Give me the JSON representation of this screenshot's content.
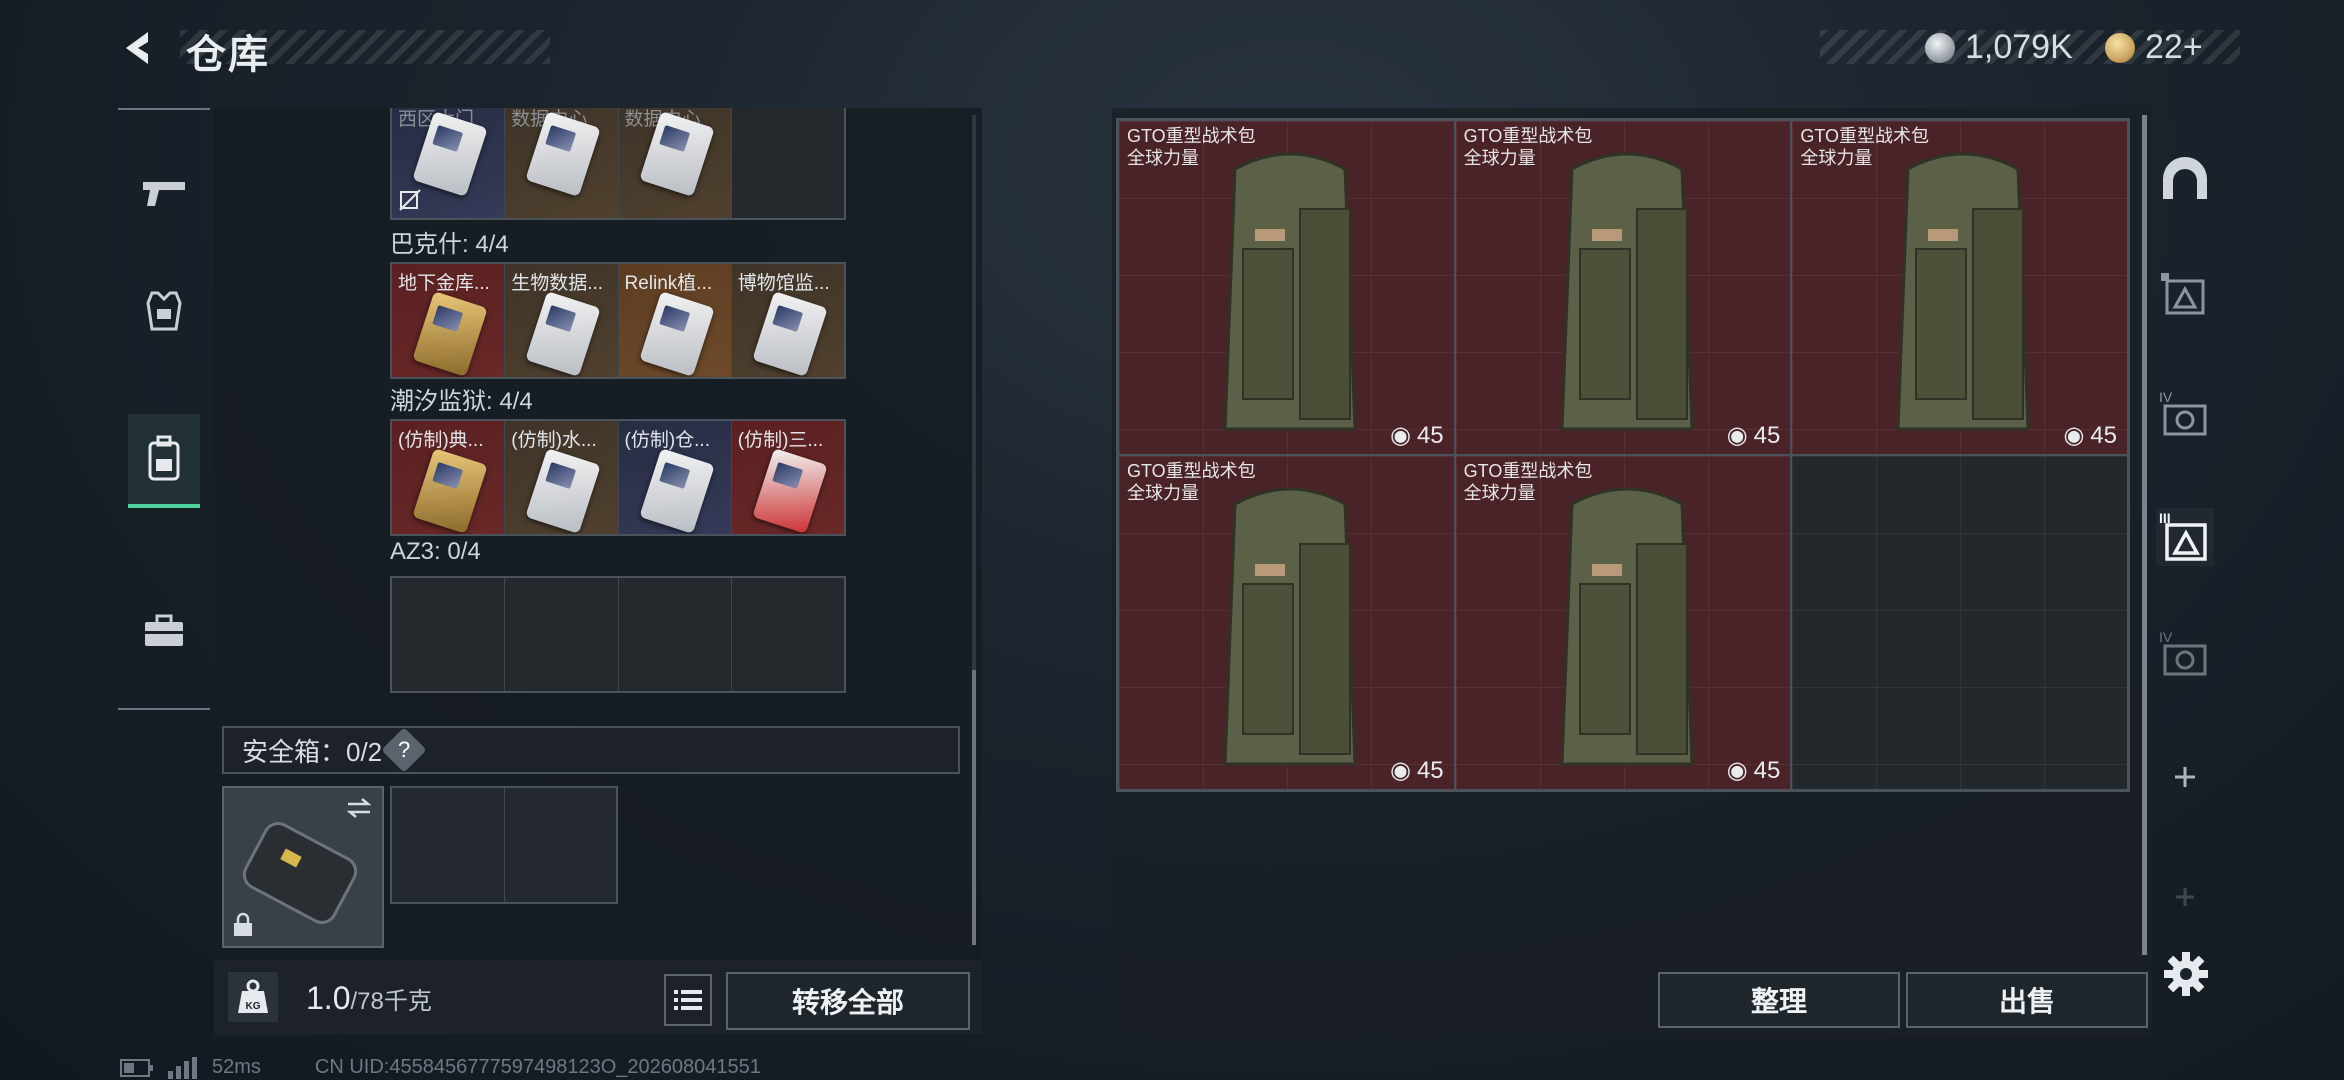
{
  "header": {
    "title": "仓库",
    "currency1_value": "1,079K",
    "currency2_value": "22+"
  },
  "left_nav": {
    "items": [
      {
        "icon": "pistol-icon"
      },
      {
        "icon": "armor-icon"
      },
      {
        "icon": "backpack-icon",
        "selected": true
      },
      {
        "icon": "toolbox-icon"
      }
    ]
  },
  "key_collections": [
    {
      "name": "",
      "count": "",
      "cards": [
        {
          "label": "西区大门",
          "bg": "navy"
        },
        {
          "label": "数据中心",
          "bg": "brown"
        },
        {
          "label": "数据中心",
          "bg": "brown"
        },
        {
          "label": "",
          "bg": "empty"
        }
      ]
    },
    {
      "name": "巴克什",
      "count": "4/4",
      "heading": "巴克什: 4/4",
      "cards": [
        {
          "label": "地下金库...",
          "bg": "red"
        },
        {
          "label": "生物数据...",
          "bg": "brown"
        },
        {
          "label": "Relink植...",
          "bg": "gold"
        },
        {
          "label": "博物馆监...",
          "bg": "brown"
        }
      ]
    },
    {
      "name": "潮汐监狱",
      "count": "4/4",
      "heading": "潮汐监狱: 4/4",
      "cards": [
        {
          "label": "(仿制)典...",
          "bg": "red"
        },
        {
          "label": "(仿制)水...",
          "bg": "brown"
        },
        {
          "label": "(仿制)仓...",
          "bg": "navy"
        },
        {
          "label": "(仿制)三...",
          "bg": "red"
        }
      ]
    },
    {
      "name": "AZ3",
      "count": "0/4",
      "heading": "AZ3: 0/4",
      "cards": [
        {
          "label": "",
          "bg": "empty"
        },
        {
          "label": "",
          "bg": "empty"
        },
        {
          "label": "",
          "bg": "empty"
        },
        {
          "label": "",
          "bg": "empty"
        }
      ]
    }
  ],
  "safe_box": {
    "label": "安全箱：0/2",
    "help": "?"
  },
  "bottom": {
    "weight": "1.0",
    "capacity": "/78千克",
    "transfer_all": "转移全部"
  },
  "stash_items": [
    {
      "name": "GTO重型战术包",
      "sub": "全球力量",
      "capacity": "45"
    },
    {
      "name": "GTO重型战术包",
      "sub": "全球力量",
      "capacity": "45"
    },
    {
      "name": "GTO重型战术包",
      "sub": "全球力量",
      "capacity": "45"
    },
    {
      "name": "GTO重型战术包",
      "sub": "全球力量",
      "capacity": "45"
    },
    {
      "name": "GTO重型战术包",
      "sub": "全球力量",
      "capacity": "45"
    }
  ],
  "right_actions": {
    "sort": "整理",
    "sell": "出售"
  },
  "right_nav": {
    "tabs": [
      "helmet-tab-icon",
      "stash-page-1-icon",
      "stash-page-4-icon",
      "stash-page-2-icon",
      "stash-page-5-icon",
      "add-page-icon",
      "add-page-disabled-icon"
    ]
  },
  "footer": {
    "ping": "52ms",
    "uid": "CN UID:4558456777597498123O_202608041551"
  },
  "colors": {
    "accent": "#4fd3a0",
    "filled_cell": "#4a2328"
  }
}
